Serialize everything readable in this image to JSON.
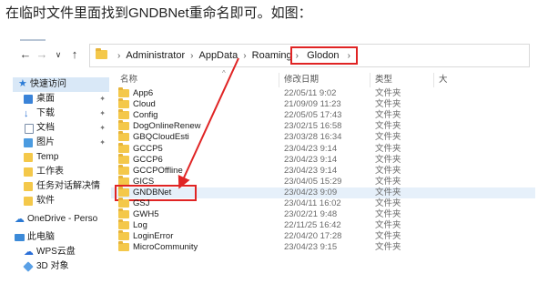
{
  "caption": "在临时文件里面找到GNDBNet重命名即可。如图：",
  "nav_buttons": [
    "←",
    "→",
    "∨",
    "↑"
  ],
  "breadcrumb": {
    "items": [
      "Administrator",
      "AppData",
      "Roaming"
    ],
    "current": "Glodon",
    "separator": "›"
  },
  "columns": {
    "name": "名称",
    "date": "修改日期",
    "type": "类型",
    "size": "大"
  },
  "sidebar": {
    "items": [
      {
        "label": "快速访问",
        "icon": "star-icon",
        "pinned": false
      },
      {
        "label": "桌面",
        "icon": "desktop-icon",
        "pinned": true
      },
      {
        "label": "下载",
        "icon": "download-icon",
        "pinned": true
      },
      {
        "label": "文档",
        "icon": "document-icon",
        "pinned": true
      },
      {
        "label": "图片",
        "icon": "picture-icon",
        "pinned": true
      },
      {
        "label": "Temp",
        "icon": "folder-icon",
        "pinned": false
      },
      {
        "label": "工作表",
        "icon": "folder-icon",
        "pinned": false
      },
      {
        "label": "任务对话解决情",
        "icon": "folder-icon",
        "pinned": false
      },
      {
        "label": "软件",
        "icon": "folder-icon",
        "pinned": false
      },
      {
        "label": "OneDrive - Perso",
        "icon": "onedrive-icon",
        "pinned": false
      },
      {
        "label": "此电脑",
        "icon": "computer-icon",
        "pinned": false
      },
      {
        "label": "WPS云盘",
        "icon": "wps-cloud-icon",
        "pinned": false
      },
      {
        "label": "3D 对象",
        "icon": "3d-objects-icon",
        "pinned": false
      }
    ],
    "pin_glyph": "✦"
  },
  "files": [
    {
      "name": "App6",
      "date": "22/05/11 9:02",
      "type": "文件夹"
    },
    {
      "name": "Cloud",
      "date": "21/09/09 11:23",
      "type": "文件夹"
    },
    {
      "name": "Config",
      "date": "22/05/05 17:43",
      "type": "文件夹"
    },
    {
      "name": "DogOnlineRenew",
      "date": "23/02/15 16:58",
      "type": "文件夹"
    },
    {
      "name": "GBQCloudEsti",
      "date": "23/03/28 16:34",
      "type": "文件夹"
    },
    {
      "name": "GCCP5",
      "date": "23/04/23 9:14",
      "type": "文件夹"
    },
    {
      "name": "GCCP6",
      "date": "23/04/23 9:14",
      "type": "文件夹"
    },
    {
      "name": "GCCPOffline",
      "date": "23/04/23 9:14",
      "type": "文件夹"
    },
    {
      "name": "GICS",
      "date": "23/04/05 15:29",
      "type": "文件夹"
    },
    {
      "name": "GNDBNet",
      "date": "23/04/23 9:09",
      "type": "文件夹",
      "selected": true
    },
    {
      "name": "GSJ",
      "date": "23/04/11 16:02",
      "type": "文件夹"
    },
    {
      "name": "GWH5",
      "date": "23/02/21 9:48",
      "type": "文件夹"
    },
    {
      "name": "Log",
      "date": "22/11/25 16:42",
      "type": "文件夹"
    },
    {
      "name": "LoginError",
      "date": "22/04/20 17:28",
      "type": "文件夹"
    },
    {
      "name": "MicroCommunity",
      "date": "23/04/23 9:15",
      "type": "文件夹"
    }
  ],
  "colors": {
    "highlight": "#e02424",
    "selected_row": "#e6f0fa",
    "folder": "#f4c84a"
  }
}
